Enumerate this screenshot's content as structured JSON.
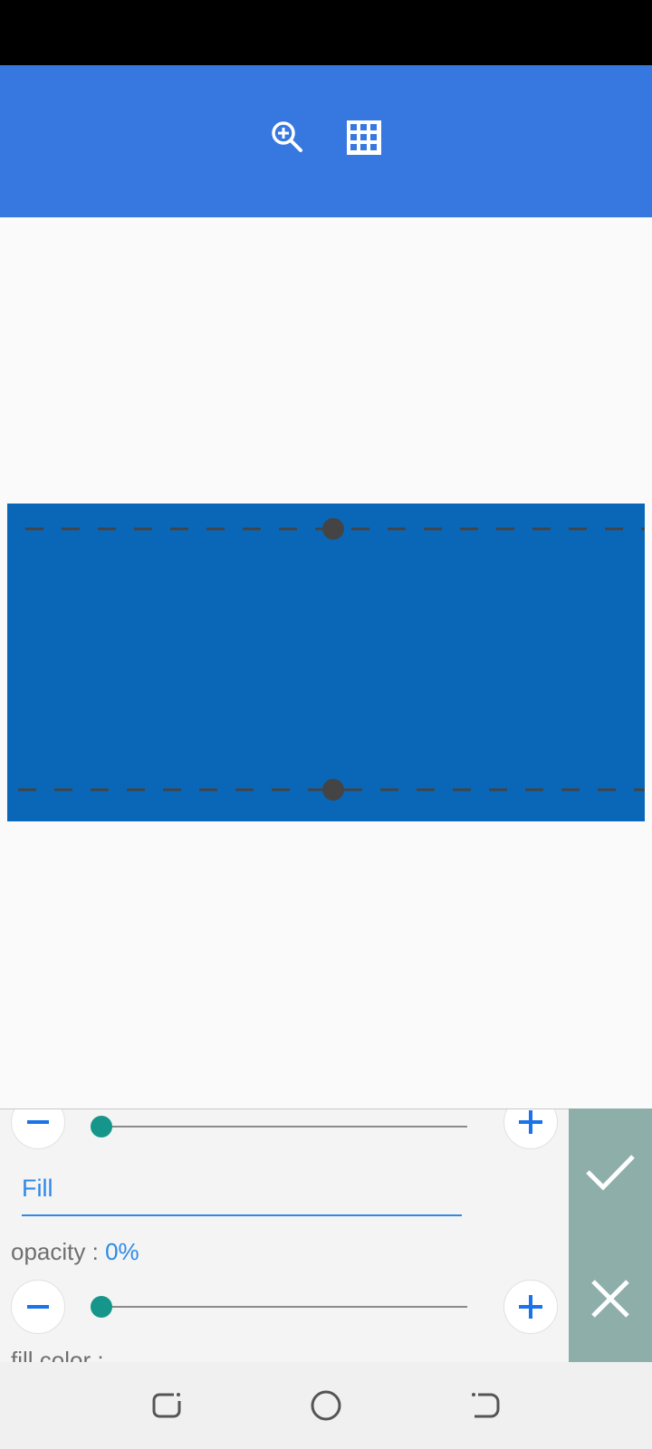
{
  "toolbar": {
    "zoom_icon": "zoom-in-icon",
    "grid_icon": "grid-icon"
  },
  "panel": {
    "tab_label": "Fill",
    "opacity_label": "opacity : ",
    "opacity_value": "0%",
    "fill_color_label": "fill color :",
    "slider_top_value": 0,
    "slider_opacity_value": 0
  },
  "actions": {
    "confirm_icon": "check-icon",
    "cancel_icon": "close-icon"
  },
  "colors": {
    "accent": "#3777e0",
    "shape_fill": "#0a67b8",
    "slider_thumb": "#16968a",
    "side_panel": "#8eaeaa"
  },
  "nav": {
    "recent_icon": "recent-apps-icon",
    "home_icon": "home-icon",
    "back_icon": "back-icon"
  }
}
